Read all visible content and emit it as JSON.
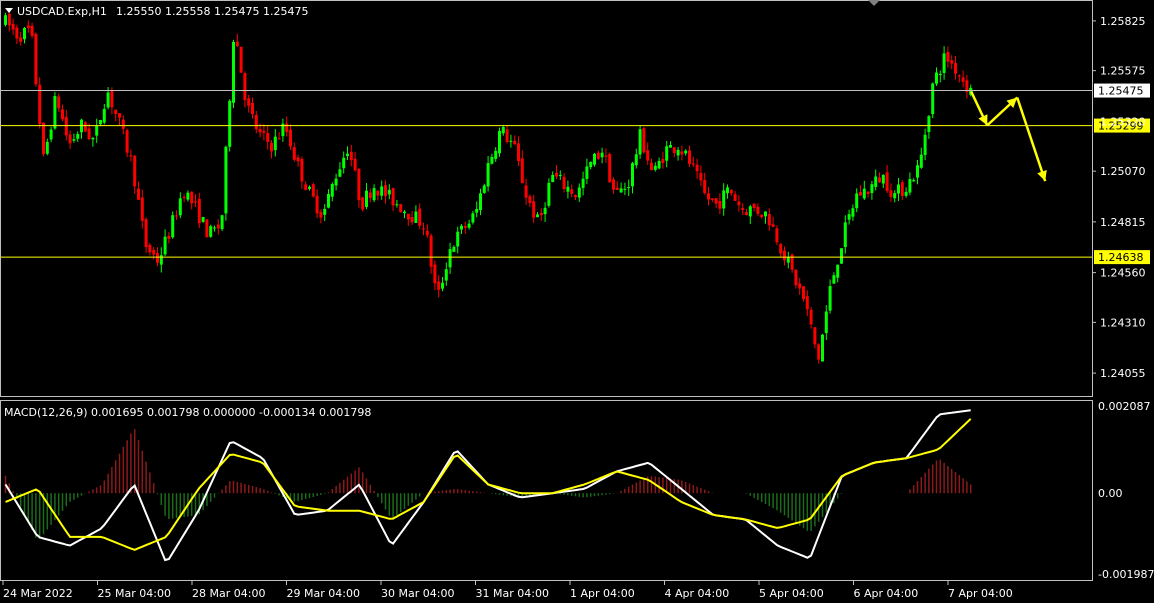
{
  "header": {
    "symbol_info": "USDCAD.Exp,H1",
    "ohlc": "1.25550 1.25558 1.25475 1.25475"
  },
  "macd": {
    "label": "MACD(12,26,9) 0.001695 0.001798 0.000000 -0.000134 0.001798"
  },
  "price_axis": {
    "ticks": [
      "1.25825",
      "1.25575",
      "1.25070",
      "1.24815",
      "1.24560",
      "1.24310",
      "1.24055"
    ],
    "hidden_tick": "1.25320"
  },
  "macd_axis": {
    "ticks": [
      "0.002087",
      "0.00",
      "-0.001987"
    ]
  },
  "levels": [
    {
      "name": "bid-line",
      "value": "1.25475",
      "color": "#c0c0c0",
      "label_bg": "#ffffff"
    },
    {
      "name": "resistance-line",
      "value": "1.25299",
      "color": "#ffff00",
      "label_bg": "#ffff00"
    },
    {
      "name": "support-line",
      "value": "1.24638",
      "color": "#ffff00",
      "label_bg": "#ffff00"
    }
  ],
  "time_axis": {
    "labels": [
      "24 Mar 2022",
      "25 Mar 04:00",
      "28 Mar 04:00",
      "29 Mar 04:00",
      "30 Mar 04:00",
      "31 Mar 04:00",
      "1 Apr 04:00",
      "4 Apr 04:00",
      "5 Apr 04:00",
      "6 Apr 04:00",
      "7 Apr 04:00"
    ]
  },
  "colors": {
    "bull": "#00ff00",
    "bear": "#ff0000",
    "macd_line": "#ffffff",
    "signal_line": "#ffff00",
    "hist_pos": "#8b1a1a",
    "hist_neg": "#1a6b1a",
    "forecast_arrow": "#ffff00",
    "frame": "#c0c0c0"
  },
  "chart_data": {
    "type": "candlestick",
    "timeframe": "H1",
    "ylim": [
      1.2394,
      1.2592
    ],
    "path": [
      1.2582,
      1.2575,
      1.2578,
      1.2512,
      1.2545,
      1.252,
      1.253,
      1.2522,
      1.2548,
      1.253,
      1.251,
      1.247,
      1.2462,
      1.2478,
      1.2498,
      1.2488,
      1.2475,
      1.248,
      1.258,
      1.254,
      1.2525,
      1.252,
      1.253,
      1.251,
      1.2495,
      1.2485,
      1.2505,
      1.252,
      1.249,
      1.25,
      1.2495,
      1.249,
      1.2485,
      1.248,
      1.2442,
      1.2468,
      1.2478,
      1.2485,
      1.251,
      1.2528,
      1.252,
      1.2495,
      1.248,
      1.2505,
      1.25,
      1.2495,
      1.251,
      1.2518,
      1.2495,
      1.25,
      1.2525,
      1.2505,
      1.2518,
      1.252,
      1.251,
      1.2495,
      1.249,
      1.2498,
      1.2488,
      1.2488,
      1.2485,
      1.247,
      1.2455,
      1.244,
      1.2412,
      1.245,
      1.2475,
      1.2495,
      1.2498,
      1.2505,
      1.2495,
      1.25,
      1.251,
      1.255,
      1.2565,
      1.2557,
      1.2547
    ],
    "forecast_arrow": [
      1.2547,
      1.253,
      1.2544,
      1.2502
    ],
    "macd_ylim": [
      -0.001987,
      0.002087
    ],
    "macd_path": [
      0.0002,
      -0.001,
      -0.0012,
      -0.0008,
      0.0002,
      -0.0016,
      -0.0004,
      0.0012,
      0.0008,
      -0.0005,
      -0.0004,
      0.0002,
      -0.0012,
      -0.0002,
      0.001,
      0.0002,
      -0.0001,
      0.0,
      0.0001,
      0.0005,
      0.0007,
      0.0001,
      -0.0005,
      -0.0006,
      -0.0012,
      -0.0015,
      0.0004,
      0.0007,
      0.0008,
      0.0018,
      0.0019
    ],
    "signal_path": [
      -0.0002,
      0.0001,
      -0.001,
      -0.001,
      -0.0013,
      -0.001,
      0.0001,
      0.0009,
      0.0007,
      -0.0003,
      -0.0004,
      -0.0004,
      -0.0006,
      -0.0002,
      0.0009,
      0.0002,
      0.0,
      0.0,
      0.0002,
      0.0005,
      0.0003,
      -0.0002,
      -0.0005,
      -0.0006,
      -0.0008,
      -0.0006,
      0.0004,
      0.0007,
      0.0008,
      0.001,
      0.0017
    ]
  }
}
